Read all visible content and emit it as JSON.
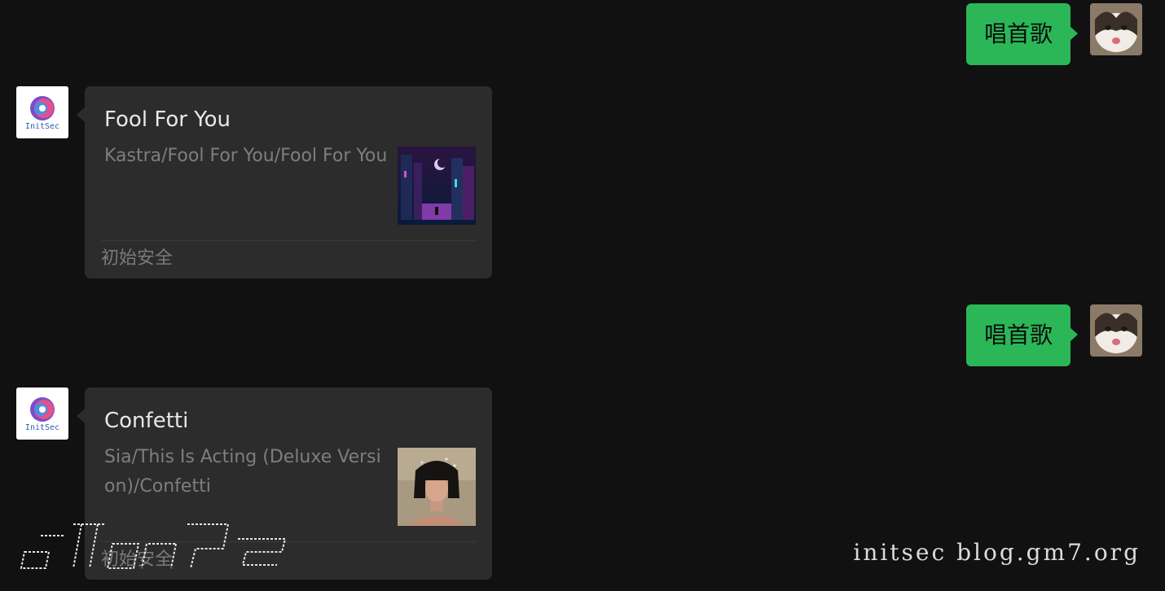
{
  "messages": [
    {
      "type": "outgoing",
      "text": "唱首歌"
    },
    {
      "type": "incoming_card",
      "title": "Fool For You",
      "desc": "Kastra/Fool For You/Fool For You",
      "source": "初始安全"
    },
    {
      "type": "outgoing",
      "text": "唱首歌"
    },
    {
      "type": "incoming_card",
      "title": "Confetti",
      "desc": "Sia/This Is Acting (Deluxe Version)/Confetti",
      "source": "初始安全"
    }
  ],
  "bot_avatar_text": "InitSec",
  "watermark": "initsec blog.gm7.org",
  "colors": {
    "background": "#111111",
    "outgoing_bubble": "#2bb758",
    "card": "#2c2c2c"
  }
}
